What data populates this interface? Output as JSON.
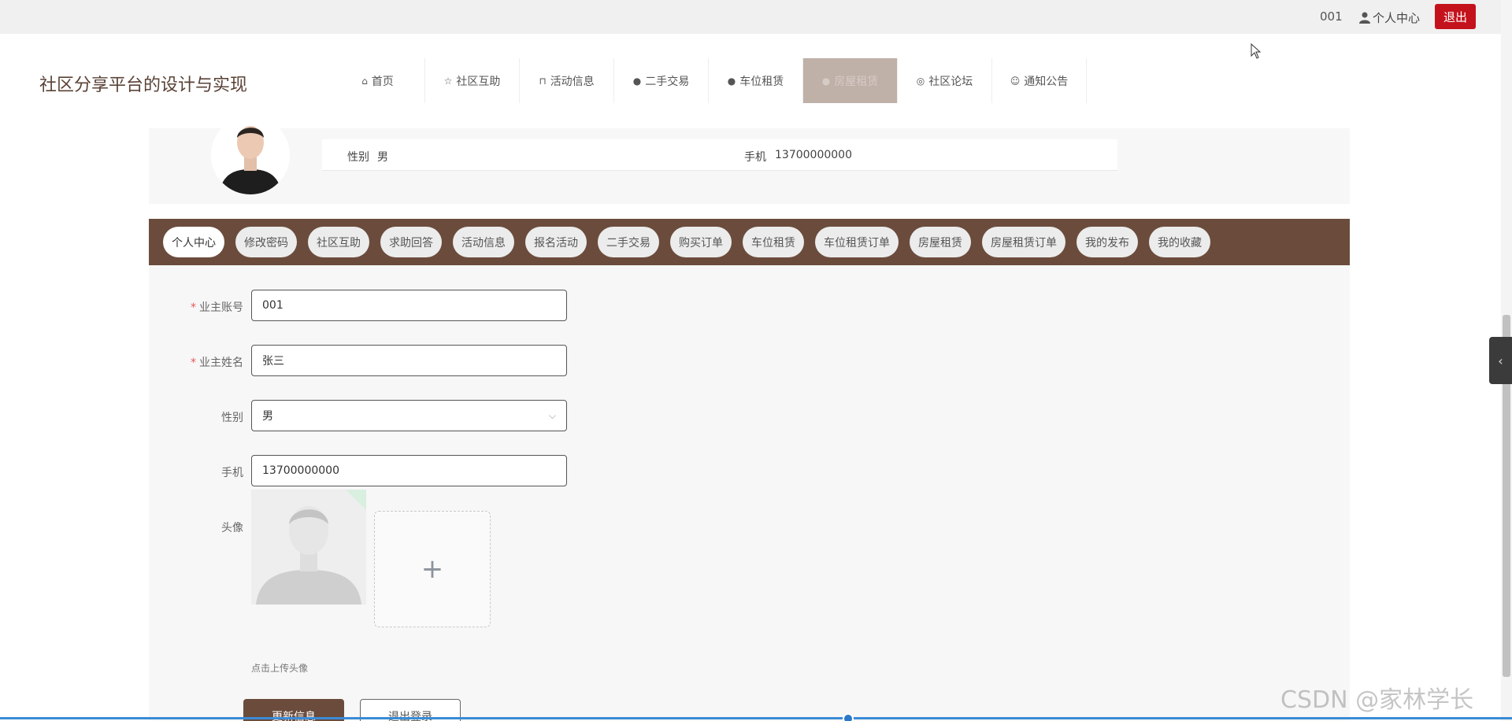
{
  "topbar": {
    "account": "001",
    "user_center": "个人中心",
    "logout": "退出"
  },
  "brand": "社区分享平台的设计与实现",
  "nav": [
    {
      "label": "首页",
      "icon": "home-icon"
    },
    {
      "label": "社区互助",
      "icon": "star-icon"
    },
    {
      "label": "活动信息",
      "icon": "bag-icon"
    },
    {
      "label": "二手交易",
      "icon": "info-circle-icon"
    },
    {
      "label": "车位租赁",
      "icon": "question-circle-icon"
    },
    {
      "label": "房屋租赁",
      "icon": "info-circle-icon",
      "active": true
    },
    {
      "label": "社区论坛",
      "icon": "dialog-icon"
    },
    {
      "label": "通知公告",
      "icon": "smile-icon"
    }
  ],
  "profile": {
    "gender_label": "性别",
    "gender_value": "男",
    "phone_label": "手机",
    "phone_value": "13700000000"
  },
  "tabs": [
    "个人中心",
    "修改密码",
    "社区互助",
    "求助回答",
    "活动信息",
    "报名活动",
    "二手交易",
    "购买订单",
    "车位租赁",
    "车位租赁订单",
    "房屋租赁",
    "房屋租赁订单",
    "我的发布",
    "我的收藏"
  ],
  "form": {
    "account_label": "业主账号",
    "account_value": "001",
    "name_label": "业主姓名",
    "name_value": "张三",
    "gender_label": "性别",
    "gender_value": "男",
    "phone_label": "手机",
    "phone_value": "13700000000",
    "avatar_label": "头像",
    "upload_plus": "+",
    "upload_tip": "点击上传头像",
    "update_button": "更新信息",
    "logout_button": "退出登录"
  },
  "side_toggle": "‹",
  "watermark": "CSDN @家林学长",
  "colors": {
    "accent": "#6b4c3c",
    "logout": "#c4121d",
    "active_nav": "#bfb0a8"
  }
}
